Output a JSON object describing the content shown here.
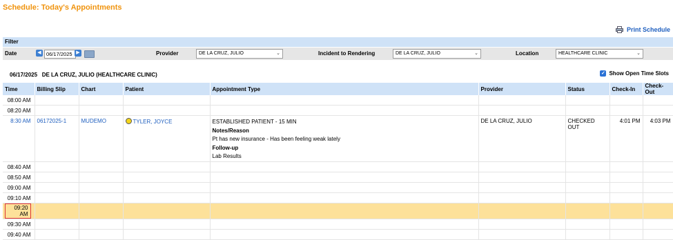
{
  "title": "Schedule: Today's Appointments",
  "print_label": "Print Schedule",
  "filter": {
    "header": "Filter",
    "date_label": "Date",
    "date_value": "06/17/2025",
    "provider_label": "Provider",
    "provider_value": "DE LA CRUZ, JULIO",
    "incident_label": "Incident to Rendering",
    "incident_value": "DE LA CRUZ, JULIO",
    "location_label": "Location",
    "location_value": "HEALTHCARE CLINIC"
  },
  "schedule_header": "06/17/2025   DE LA CRUZ, JULIO (HEALTHCARE CLINIC)",
  "show_open_label": "Show Open Time Slots",
  "columns": [
    "Time",
    "Billing Slip",
    "Chart",
    "Patient",
    "Appointment Type",
    "Provider",
    "Status",
    "Check-In",
    "Check-Out"
  ],
  "rows": [
    {
      "time": "08:00 AM"
    },
    {
      "time": "08:20 AM"
    },
    {
      "time": "8:30 AM",
      "billing_slip": "06172025-1",
      "chart": "MUDEMO",
      "patient": "TYLER, JOYCE",
      "appointment_type": "ESTABLISHED PATIENT - 15 MIN",
      "notes_label": "Notes/Reason",
      "notes": "Pt has new insurance - Has been feeling weak lately",
      "followup_label": "Follow-up",
      "followup": "Lab Results",
      "provider": "DE LA CRUZ, JULIO",
      "status": "CHECKED OUT",
      "check_in": "4:01 PM",
      "check_out": "4:03 PM"
    },
    {
      "time": "08:40 AM"
    },
    {
      "time": "08:50 AM"
    },
    {
      "time": "09:00 AM"
    },
    {
      "time": "09:10 AM"
    },
    {
      "time": "09:20 AM"
    },
    {
      "time": "09:30 AM"
    },
    {
      "time": "09:40 AM"
    }
  ],
  "colors": {
    "title": "#f0930d",
    "header_bg": "#cfe2f7",
    "link": "#1f5fbf",
    "highlight_row": "#fde19a",
    "highlight_border": "#dd3333"
  },
  "icons": [
    "printer-icon",
    "prev-date-icon",
    "next-date-icon",
    "calendar-icon",
    "checkbox-checked-icon",
    "status-dot-icon",
    "chevron-down-icon"
  ]
}
